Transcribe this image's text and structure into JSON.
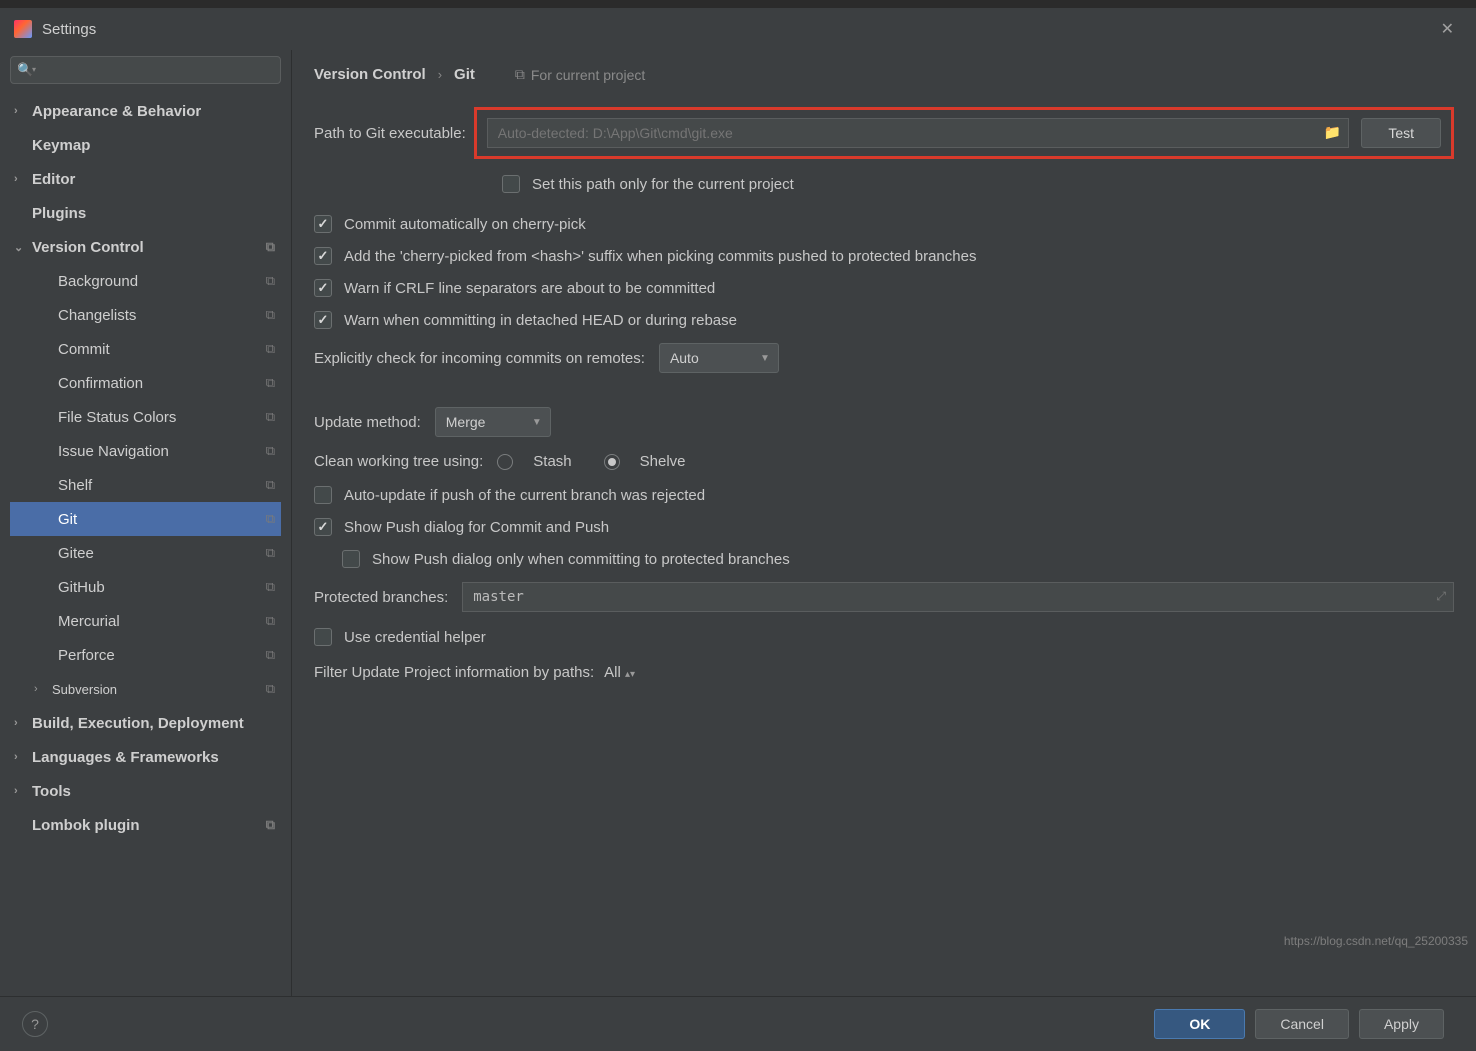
{
  "window": {
    "title": "Settings"
  },
  "search": {
    "placeholder": ""
  },
  "sidebar": {
    "items": [
      {
        "label": "Appearance & Behavior",
        "chev": "›",
        "bold": true
      },
      {
        "label": "Keymap",
        "chev": "",
        "bold": true
      },
      {
        "label": "Editor",
        "chev": "›",
        "bold": true
      },
      {
        "label": "Plugins",
        "chev": "",
        "bold": true
      },
      {
        "label": "Version Control",
        "chev": "⌄",
        "bold": true,
        "copy": true
      },
      {
        "label": "Background",
        "child": true,
        "copy": true
      },
      {
        "label": "Changelists",
        "child": true,
        "copy": true
      },
      {
        "label": "Commit",
        "child": true,
        "copy": true
      },
      {
        "label": "Confirmation",
        "child": true,
        "copy": true
      },
      {
        "label": "File Status Colors",
        "child": true,
        "copy": true
      },
      {
        "label": "Issue Navigation",
        "child": true,
        "copy": true
      },
      {
        "label": "Shelf",
        "child": true,
        "copy": true
      },
      {
        "label": "Git",
        "child": true,
        "copy": true,
        "selected": true
      },
      {
        "label": "Gitee",
        "child": true,
        "copy": true
      },
      {
        "label": "GitHub",
        "child": true,
        "copy": true
      },
      {
        "label": "Mercurial",
        "child": true,
        "copy": true
      },
      {
        "label": "Perforce",
        "child": true,
        "copy": true
      },
      {
        "label": "Subversion",
        "chev": "›",
        "lvl1": true,
        "copy": true
      },
      {
        "label": "Build, Execution, Deployment",
        "chev": "›",
        "bold": true
      },
      {
        "label": "Languages & Frameworks",
        "chev": "›",
        "bold": true
      },
      {
        "label": "Tools",
        "chev": "›",
        "bold": true
      },
      {
        "label": "Lombok plugin",
        "chev": "",
        "bold": true,
        "copy": true
      }
    ]
  },
  "breadcrumb": {
    "parent": "Version Control",
    "current": "Git",
    "for_project": "For current project"
  },
  "git": {
    "path_label": "Path to Git executable:",
    "path_placeholder": "Auto-detected: D:\\App\\Git\\cmd\\git.exe",
    "test_button": "Test",
    "set_path_only": "Set this path only for the current project",
    "commit_cherry": "Commit automatically on cherry-pick",
    "add_suffix": "Add the 'cherry-picked from <hash>' suffix when picking commits pushed to protected branches",
    "warn_crlf": "Warn if CRLF line separators are about to be committed",
    "warn_detached": "Warn when committing in detached HEAD or during rebase",
    "explicitly_label": "Explicitly check for incoming commits on remotes:",
    "explicitly_value": "Auto",
    "update_method_label": "Update method:",
    "update_method_value": "Merge",
    "clean_tree_label": "Clean working tree using:",
    "stash": "Stash",
    "shelve": "Shelve",
    "auto_update": "Auto-update if push of the current branch was rejected",
    "show_push": "Show Push dialog for Commit and Push",
    "show_push_protected": "Show Push dialog only when committing to protected branches",
    "protected_label": "Protected branches:",
    "protected_value": "master",
    "use_credential": "Use credential helper",
    "filter_label": "Filter Update Project information by paths:",
    "filter_value": "All"
  },
  "footer": {
    "ok": "OK",
    "cancel": "Cancel",
    "apply": "Apply"
  },
  "watermark": "https://blog.csdn.net/qq_25200335"
}
